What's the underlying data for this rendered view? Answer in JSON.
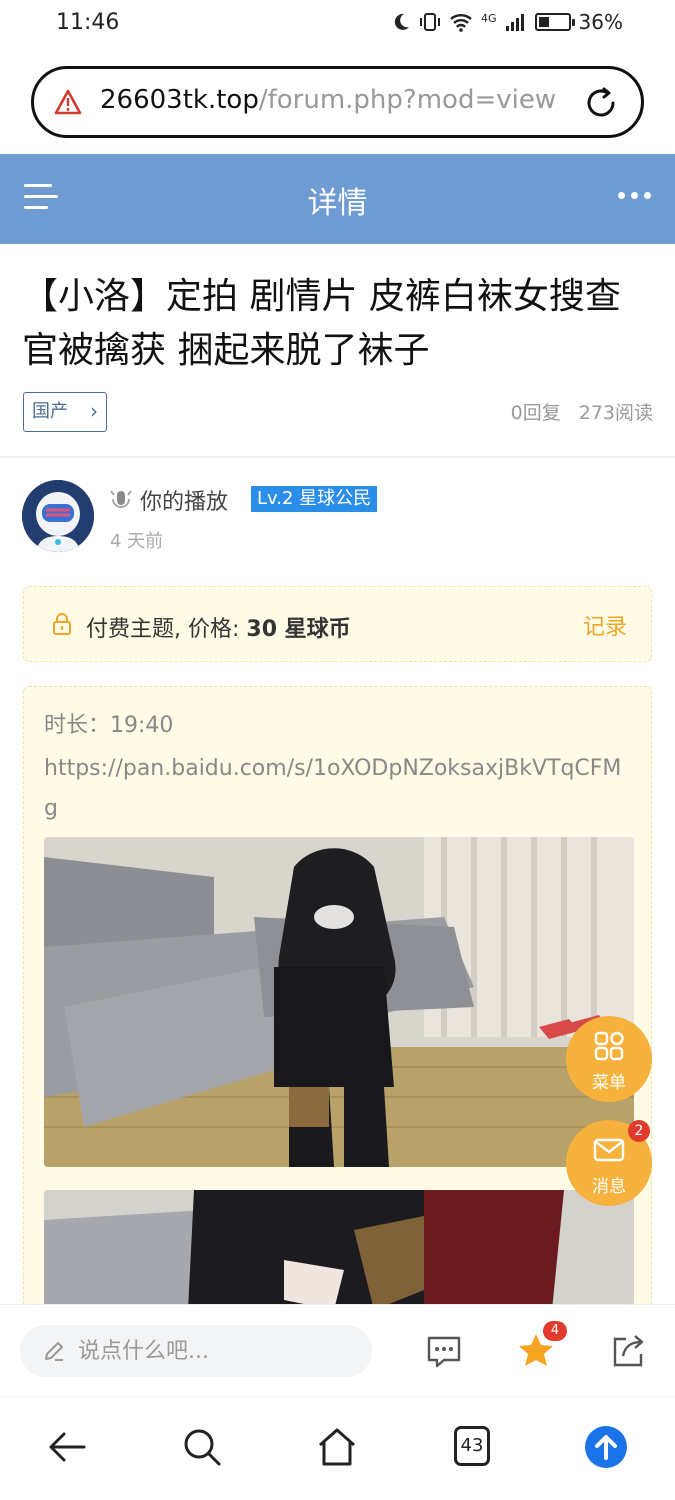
{
  "status_bar": {
    "time": "11:46",
    "network": "4G",
    "battery": "36%",
    "battery_level": 0.36
  },
  "url_bar": {
    "host": "26603tk.top",
    "path": "/forum.php?mod=view"
  },
  "header": {
    "title": "详情"
  },
  "post": {
    "title": "【小洛】定拍 剧情片 皮裤白袜女搜查官被擒获 捆起来脱了袜子",
    "category": "国产",
    "replies": "0回复",
    "views": "273阅读"
  },
  "author": {
    "name": "你的播放",
    "level": "Lv.2 星球公民",
    "time": "4 天前"
  },
  "paid": {
    "label": "付费主题, 价格: ",
    "price": "30 星球币",
    "record": "记录"
  },
  "content": {
    "duration": "时长：19:40",
    "link": "https://pan.baidu.com/s/1oXODpNZoksaxjBkVTqCFMg"
  },
  "floating": {
    "menu_label": "菜单",
    "message_label": "消息",
    "message_badge": "2"
  },
  "comment_bar": {
    "placeholder": "说点什么吧...",
    "favorite_badge": "4"
  },
  "nav": {
    "tab_count": "43"
  },
  "colors": {
    "header_bg": "#6f9bd3",
    "accent_orange": "#f6b23c",
    "level_badge": "#2a8ee8",
    "badge_red": "#e23b2e",
    "paid_bg": "#fffbe6"
  }
}
